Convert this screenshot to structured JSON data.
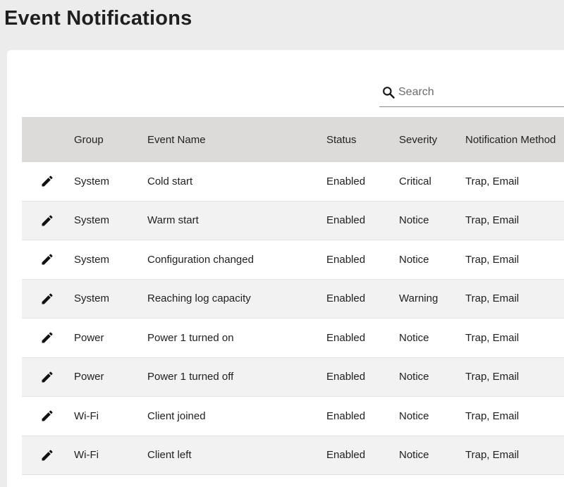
{
  "page": {
    "title": "Event Notifications"
  },
  "search": {
    "placeholder": "Search"
  },
  "table": {
    "headers": {
      "group": "Group",
      "event_name": "Event Name",
      "status": "Status",
      "severity": "Severity",
      "notification_method": "Notification Method"
    },
    "rows": [
      {
        "group": "System",
        "event_name": "Cold start",
        "status": "Enabled",
        "severity": "Critical",
        "notification_method": "Trap, Email"
      },
      {
        "group": "System",
        "event_name": "Warm start",
        "status": "Enabled",
        "severity": "Notice",
        "notification_method": "Trap, Email"
      },
      {
        "group": "System",
        "event_name": "Configuration changed",
        "status": "Enabled",
        "severity": "Notice",
        "notification_method": "Trap, Email"
      },
      {
        "group": "System",
        "event_name": "Reaching log capacity",
        "status": "Enabled",
        "severity": "Warning",
        "notification_method": "Trap, Email"
      },
      {
        "group": "Power",
        "event_name": "Power 1 turned on",
        "status": "Enabled",
        "severity": "Notice",
        "notification_method": "Trap, Email"
      },
      {
        "group": "Power",
        "event_name": "Power 1 turned off",
        "status": "Enabled",
        "severity": "Notice",
        "notification_method": "Trap, Email"
      },
      {
        "group": "Wi-Fi",
        "event_name": "Client joined",
        "status": "Enabled",
        "severity": "Notice",
        "notification_method": "Trap, Email"
      },
      {
        "group": "Wi-Fi",
        "event_name": "Client left",
        "status": "Enabled",
        "severity": "Notice",
        "notification_method": "Trap, Email"
      }
    ]
  },
  "icons": {
    "edit": "pencil-icon",
    "search": "search-icon"
  },
  "colors": {
    "header_bg": "#dcdbd9",
    "alt_row_bg": "#f2f2f2",
    "page_bg": "#ececec"
  }
}
